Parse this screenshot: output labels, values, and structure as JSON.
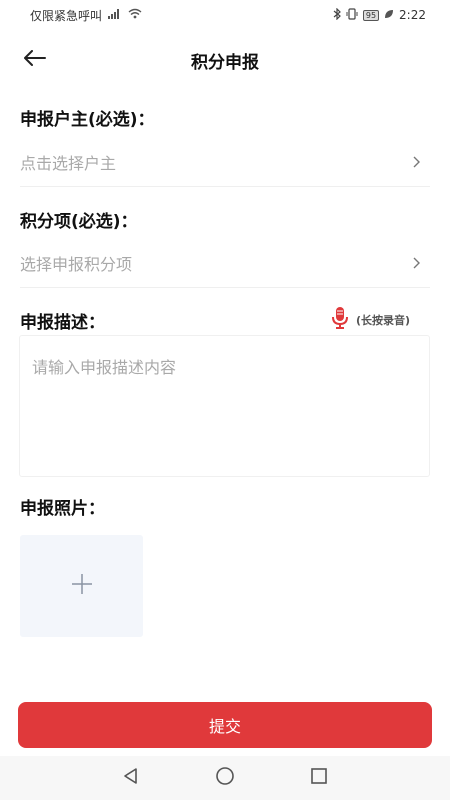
{
  "status_bar": {
    "carrier": "仅限紧急呼叫",
    "battery": "95",
    "time": "2:22"
  },
  "header": {
    "title": "积分申报"
  },
  "form": {
    "owner_label": "申报户主(必选)：",
    "owner_placeholder": "点击选择户主",
    "item_label": "积分项(必选)：",
    "item_placeholder": "选择申报积分项",
    "desc_label": "申报描述：",
    "voice_hint": "(长按录音)",
    "desc_placeholder": "请输入申报描述内容",
    "photo_label": "申报照片："
  },
  "actions": {
    "submit_label": "提交"
  },
  "colors": {
    "accent": "#e0393b",
    "placeholder": "#a9a9a9"
  },
  "icons": {
    "back": "arrow-left-icon",
    "chevron": "chevron-right-icon",
    "mic": "microphone-icon",
    "add": "plus-icon"
  }
}
